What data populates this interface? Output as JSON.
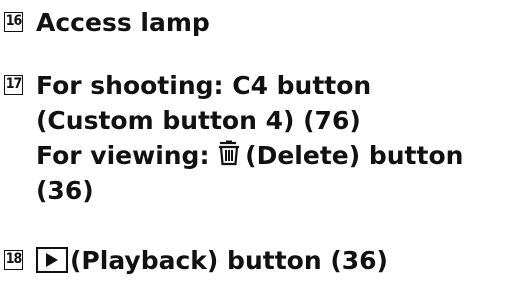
{
  "items": [
    {
      "number": "16",
      "text": "Access lamp"
    },
    {
      "number": "17",
      "line1": "For shooting: C4 button",
      "line2": "(Custom button 4) (76)",
      "line3_prefix": "For viewing: ",
      "line3_suffix": "(Delete) button",
      "line4": "(36)",
      "icon": "trash-icon"
    },
    {
      "number": "18",
      "text": "(Playback) button (36)",
      "icon": "play-icon"
    }
  ]
}
